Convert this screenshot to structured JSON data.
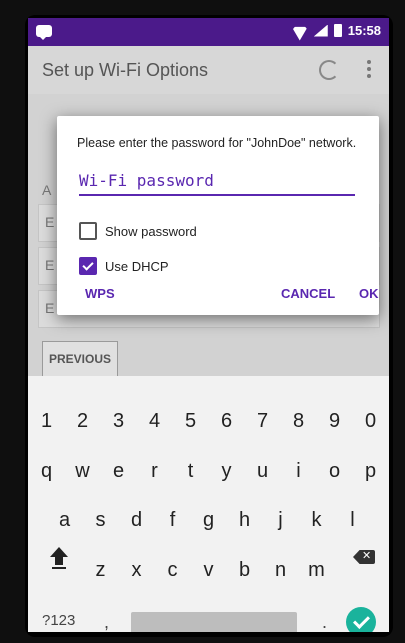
{
  "status_bar": {
    "time": "15:58"
  },
  "app_bar": {
    "title": "Set up Wi-Fi Options"
  },
  "background": {
    "row_letters": [
      "E",
      "E",
      "E"
    ],
    "section_letter": "A",
    "previous_button": "PREVIOUS"
  },
  "dialog": {
    "message": "Please enter the password for \"JohnDoe\" network.",
    "password_placeholder": "Wi-Fi password",
    "password_value": "",
    "show_password_label": "Show password",
    "show_password_checked": false,
    "use_dhcp_label": "Use DHCP",
    "use_dhcp_checked": true,
    "wps_button": "WPS",
    "cancel_button": "CANCEL",
    "ok_button": "OK"
  },
  "keyboard": {
    "row_numbers": [
      "1",
      "2",
      "3",
      "4",
      "5",
      "6",
      "7",
      "8",
      "9",
      "0"
    ],
    "row1": [
      "q",
      "w",
      "e",
      "r",
      "t",
      "y",
      "u",
      "i",
      "o",
      "p"
    ],
    "row2": [
      "a",
      "s",
      "d",
      "f",
      "g",
      "h",
      "j",
      "k",
      "l"
    ],
    "row3": [
      "z",
      "x",
      "c",
      "v",
      "b",
      "n",
      "m"
    ],
    "symbols_key": "?123",
    "comma_key": ",",
    "period_key": "."
  },
  "colors": {
    "accent": "#5a27b0",
    "status_bar": "#4b1a8a",
    "enter": "#1ab39c"
  }
}
